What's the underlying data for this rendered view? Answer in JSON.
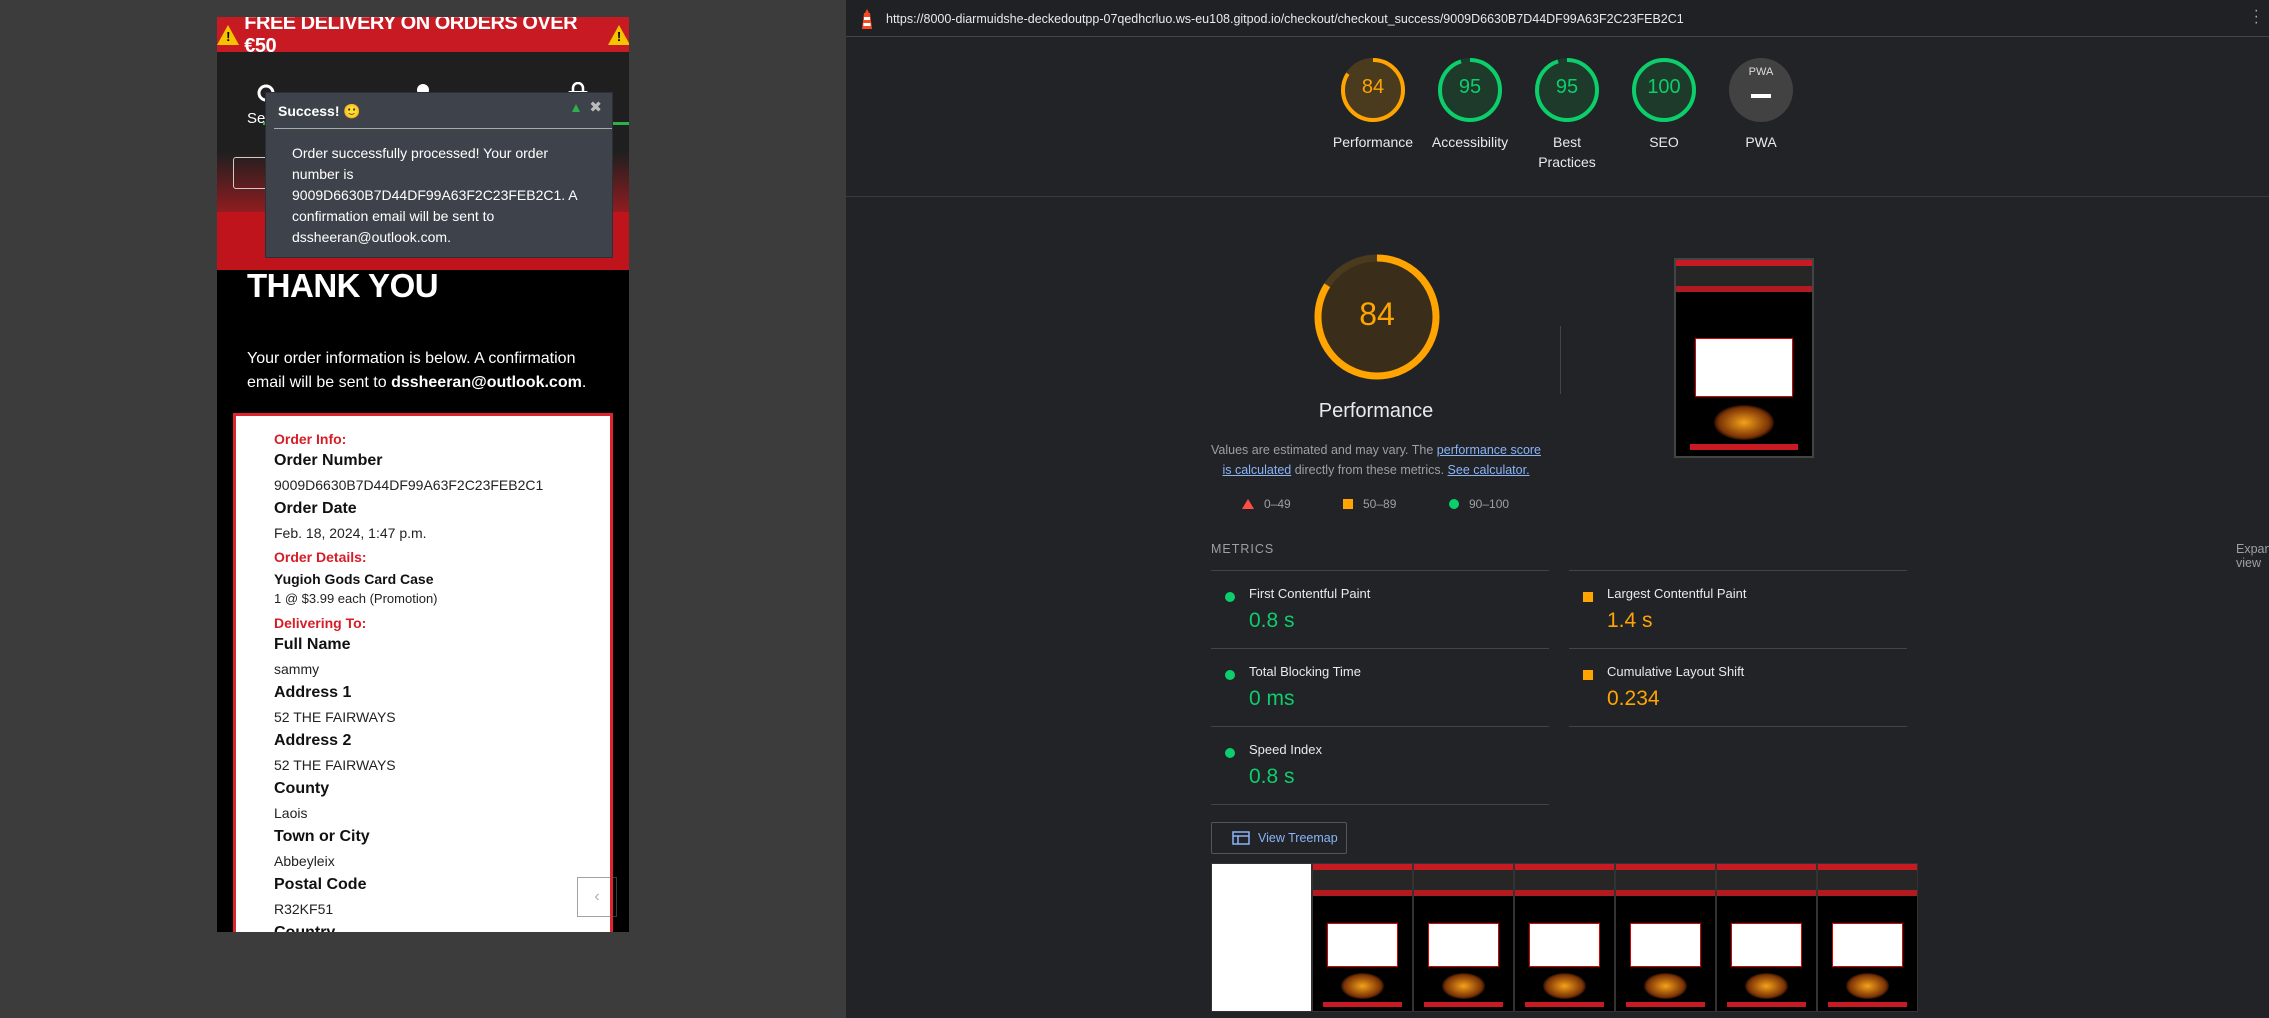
{
  "phone": {
    "promo_text": "FREE DELIVERY ON ORDERS OVER €50",
    "search_label": "Se",
    "toast": {
      "title": "Success! 🙂",
      "close_glyph": "✖",
      "message": "Order successfully processed! Your order number is 9009D6630B7D44DF99A63F2C23FEB2C1. A confirmation email will be sent to dssheeran@outlook.com."
    },
    "heading": "THANK YOU",
    "intro_text": "Your order information is below. A confirmation email will be sent to ",
    "intro_email": "dssheeran@outlook.com",
    "intro_end": ".",
    "card": {
      "order_info_label": "Order Info:",
      "order_number_label": "Order Number",
      "order_number": "9009D6630B7D44DF99A63F2C23FEB2C1",
      "order_date_label": "Order Date",
      "order_date": "Feb. 18, 2024, 1:47 p.m.",
      "order_details_label": "Order Details:",
      "product_name": "Yugioh Gods Card Case",
      "product_line": "1 @ $3.99 each (Promotion)",
      "delivering_label": "Delivering To:",
      "full_name_label": "Full Name",
      "full_name": "sammy",
      "address1_label": "Address 1",
      "address1": "52 THE FAIRWAYS",
      "address2_label": "Address 2",
      "address2": "52 THE FAIRWAYS",
      "county_label": "County",
      "county": "Laois",
      "town_label": "Town or City",
      "town": "Abbeyleix",
      "postal_label": "Postal Code",
      "postal": "R32KF51",
      "country_label": "Country"
    },
    "icons": [
      "search-icon",
      "user-icon",
      "shopping-bag-icon",
      "warning-icon",
      "chevron-up-icon"
    ]
  },
  "lighthouse": {
    "url": "https://8000-diarmuidshe-deckedoutpp-07qedhcrluo.ws-eu108.gitpod.io/checkout/checkout_success/9009D6630B7D44DF99A63F2C23FEB2C1",
    "scores": [
      {
        "label": "Performance",
        "value": "84",
        "score": 84,
        "color": "#ffa400"
      },
      {
        "label": "Accessibility",
        "value": "95",
        "score": 95,
        "color": "#0cce6b"
      },
      {
        "label": "Best Practices",
        "value": "95",
        "score": 95,
        "color": "#0cce6b"
      },
      {
        "label": "SEO",
        "value": "100",
        "score": 100,
        "color": "#0cce6b"
      }
    ],
    "pwa_label": "PWA",
    "pwa_badge": "PWA",
    "perf_score": "84",
    "perf_title": "Performance",
    "perf_desc_1": "Values are estimated and may vary. The ",
    "perf_desc_link": "performance score is calculated",
    "perf_desc_2": " directly from these metrics. ",
    "perf_desc_calc": "See calculator.",
    "legend": {
      "fail": "0–49",
      "average": "50–89",
      "pass": "90–100"
    },
    "metrics_header": "METRICS",
    "expand_view": "Expand view",
    "metrics": [
      {
        "label": "First Contentful Paint",
        "value": "0.8 s",
        "status": "pass"
      },
      {
        "label": "Largest Contentful Paint",
        "value": "1.4 s",
        "status": "average"
      },
      {
        "label": "Total Blocking Time",
        "value": "0 ms",
        "status": "pass"
      },
      {
        "label": "Cumulative Layout Shift",
        "value": "0.234",
        "status": "average"
      },
      {
        "label": "Speed Index",
        "value": "0.8 s",
        "status": "pass"
      }
    ],
    "view_treemap": "View Treemap",
    "colors": {
      "pass": "#0cce6b",
      "average": "#ffa400",
      "fail": "#ff4e42",
      "link": "#8ab4f8"
    }
  }
}
